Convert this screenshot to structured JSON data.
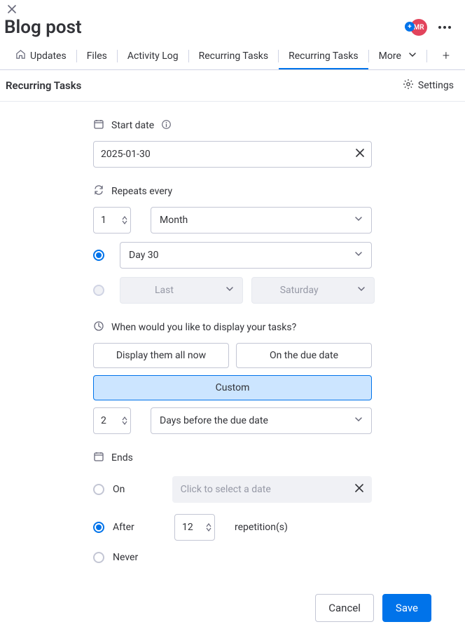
{
  "page": {
    "title": "Blog post",
    "panel_title": "Recurring Tasks",
    "avatar_initials": "MR"
  },
  "tabs": {
    "updates": "Updates",
    "files": "Files",
    "activity_log": "Activity Log",
    "recurring_tasks_1": "Recurring Tasks",
    "recurring_tasks_2": "Recurring Tasks",
    "more": "More"
  },
  "settings_label": "Settings",
  "start_date": {
    "label": "Start date",
    "value": "2025-01-30"
  },
  "repeats": {
    "label": "Repeats every",
    "count": "1",
    "unit": "Month",
    "option_day": "Day 30",
    "option_last_label": "Last",
    "option_weekday": "Saturday"
  },
  "display": {
    "label": "When would you like to display your tasks?",
    "opt_all_now": "Display them all now",
    "opt_due": "On the due date",
    "opt_custom": "Custom",
    "count": "2",
    "unit": "Days before the due date"
  },
  "ends": {
    "label": "Ends",
    "on_label": "On",
    "on_placeholder": "Click to select a date",
    "after_label": "After",
    "after_count": "12",
    "after_suffix": "repetition(s)",
    "never_label": "Never"
  },
  "footer": {
    "cancel": "Cancel",
    "save": "Save"
  }
}
